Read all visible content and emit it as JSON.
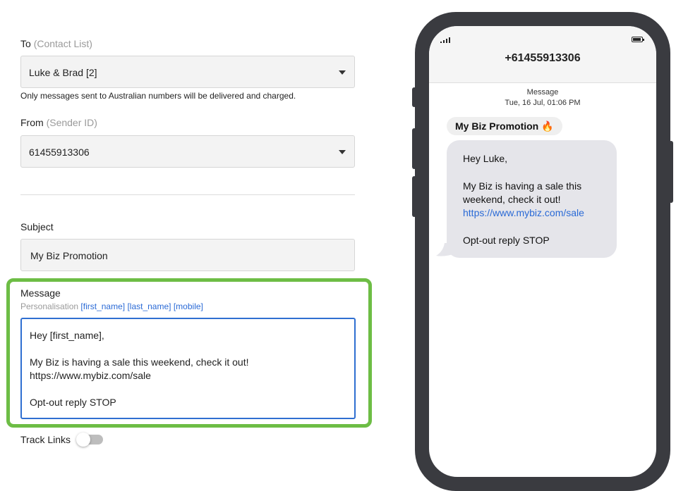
{
  "form": {
    "to": {
      "label": "To",
      "hint": "(Contact List)",
      "value": "Luke & Brad [2]",
      "note": "Only messages sent to Australian numbers will be delivered and charged."
    },
    "from": {
      "label": "From",
      "hint": "(Sender ID)",
      "value": "61455913306"
    },
    "subject": {
      "label": "Subject",
      "value": "My Biz Promotion"
    },
    "message": {
      "label": "Message",
      "personalisation_label": "Personalisation",
      "tags": [
        "[first_name]",
        "[last_name]",
        "[mobile]"
      ],
      "lines": [
        "Hey [first_name],",
        "My Biz is having a sale this weekend, check it out!",
        "https://www.mybiz.com/sale",
        "Opt-out reply STOP"
      ]
    },
    "track_links": {
      "label": "Track Links",
      "enabled": false
    }
  },
  "preview": {
    "phone_number": "+61455913306",
    "meta_title": "Message",
    "meta_time": "Tue, 16 Jul, 01:06 PM",
    "sender": "My Biz Promotion",
    "sender_emoji": "🔥",
    "bubble": {
      "greeting": "Hey Luke,",
      "line1": "My Biz is having a sale this",
      "line2": "weekend, check it out!",
      "link": "https://www.mybiz.com/sale",
      "optout": "Opt-out reply STOP"
    }
  },
  "colors": {
    "highlight": "#6dbd45",
    "focus": "#2f6fd1",
    "link": "#2a6ad6",
    "phone_frame": "#3a3b40",
    "bubble": "#e5e5ea"
  },
  "icons": {
    "select_caret": "caret-down-icon",
    "signal": "signal-icon",
    "battery": "battery-icon"
  }
}
